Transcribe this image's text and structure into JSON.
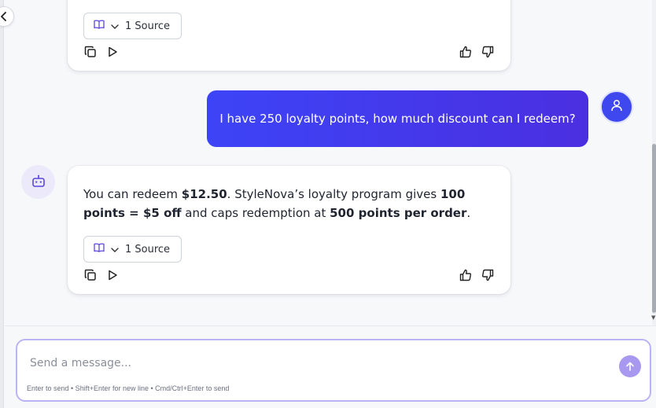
{
  "colors": {
    "accent": "#3d44f7",
    "user_bubble_start": "#3d44f7",
    "user_bubble_end": "#4a2fe0",
    "send_button": "#a898f0",
    "composer_border": "#b9b4f2"
  },
  "sidebar": {
    "collapse_icon": "chevron-left-icon"
  },
  "messages": [
    {
      "role": "assistant",
      "source_label": "1 Source",
      "icons": [
        "book-icon",
        "chevron-down-icon",
        "copy-icon",
        "play-icon",
        "thumbs-up-icon",
        "thumbs-down-icon"
      ]
    },
    {
      "role": "user",
      "text": "I have 250 loyalty points, how much discount can I redeem?",
      "avatar_icon": "user-icon"
    },
    {
      "role": "assistant",
      "avatar_icon": "robot-icon",
      "text_parts": [
        "You can redeem ",
        "$12.50",
        ". StyleNova’s loyalty program gives ",
        "100 points = $5 off",
        " and caps redemption at ",
        "500 points per order",
        "."
      ],
      "source_label": "1 Source",
      "icons": [
        "book-icon",
        "chevron-down-icon",
        "copy-icon",
        "play-icon",
        "thumbs-up-icon",
        "thumbs-down-icon"
      ]
    }
  ],
  "composer": {
    "placeholder": "Send a message...",
    "value": "",
    "hint": "Enter to send • Shift+Enter for new line • Cmd/Ctrl+Enter to send",
    "send_icon": "arrow-up-icon"
  }
}
